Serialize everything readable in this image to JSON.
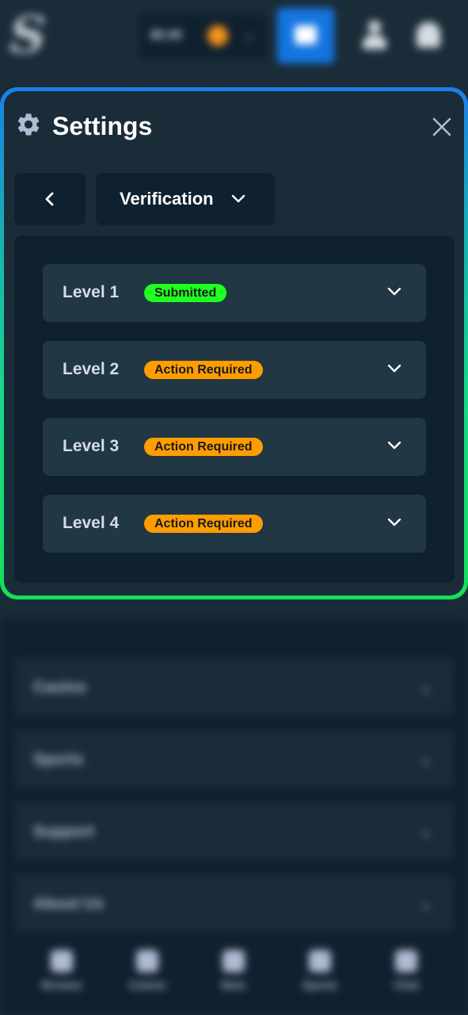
{
  "header": {
    "logo_text": "S",
    "wallet_amount": "$0.00",
    "user_icon": "user-icon",
    "bell_icon": "bell-icon"
  },
  "settings": {
    "title": "Settings",
    "gear_icon": "gear-icon",
    "close_icon": "close-icon",
    "back_icon": "chevron-left-icon",
    "section_label": "Verification",
    "levels": [
      {
        "label": "Level 1",
        "status": "Submitted",
        "status_color": "#1fff20"
      },
      {
        "label": "Level 2",
        "status": "Action Required",
        "status_color": "#ff9d00"
      },
      {
        "label": "Level 3",
        "status": "Action Required",
        "status_color": "#ff9d00"
      },
      {
        "label": "Level 4",
        "status": "Action Required",
        "status_color": "#ff9d00"
      }
    ]
  },
  "background_menu": {
    "items": [
      "Casino",
      "Sports",
      "Support",
      "About Us"
    ]
  },
  "bottom_nav": {
    "items": [
      "Browse",
      "Casino",
      "Bets",
      "Sports",
      "Chat"
    ]
  },
  "colors": {
    "page_bg": "#1a2c38",
    "panel_bg": "#0f212e",
    "row_bg": "#213743",
    "accent_blue": "#1475e1",
    "border_gradient_top": "#1c7ee8",
    "border_gradient_bottom": "#14e05b"
  }
}
